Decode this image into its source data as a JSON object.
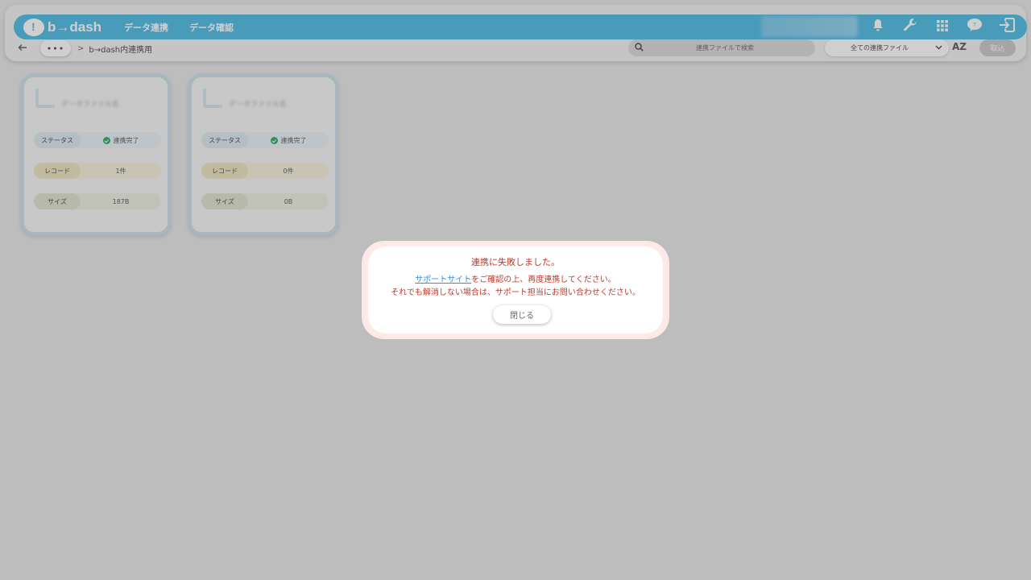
{
  "header": {
    "logo_text": "b→dash",
    "nav": [
      "データ連携",
      "データ確認"
    ],
    "icons": [
      "bell-icon",
      "wrench-icon",
      "grid-icon",
      "chat-help-icon",
      "logout-icon"
    ]
  },
  "toolbar": {
    "more_label": "•••",
    "breadcrumb_sep": ">",
    "breadcrumb": "b→dash内連携用",
    "search_placeholder": "連携ファイルで検索",
    "filter_value": "全ての連携ファイル",
    "sort_label": "AZ",
    "import_label": "取込"
  },
  "cards": [
    {
      "title": "データファイル名",
      "rows": [
        {
          "key": "ステータス",
          "value": "連携完了"
        },
        {
          "key": "レコード",
          "value": "1件"
        },
        {
          "key": "サイズ",
          "value": "187B"
        }
      ]
    },
    {
      "title": "データファイル名",
      "rows": [
        {
          "key": "ステータス",
          "value": "連携完了"
        },
        {
          "key": "レコード",
          "value": "0件"
        },
        {
          "key": "サイズ",
          "value": "0B"
        }
      ]
    }
  ],
  "modal": {
    "title": "連携に失敗しました。",
    "link_text": "サポートサイト",
    "line1_rest": "をご確認の上、再度連携してください。",
    "line2": "それでも解消しない場合は、サポート担当にお問い合わせください。",
    "close_label": "閉じる"
  },
  "colors": {
    "header_bg": "#5bbfe6",
    "error_text": "#c0392b",
    "link": "#3a8fd9",
    "status_ok": "#3fae6e"
  }
}
